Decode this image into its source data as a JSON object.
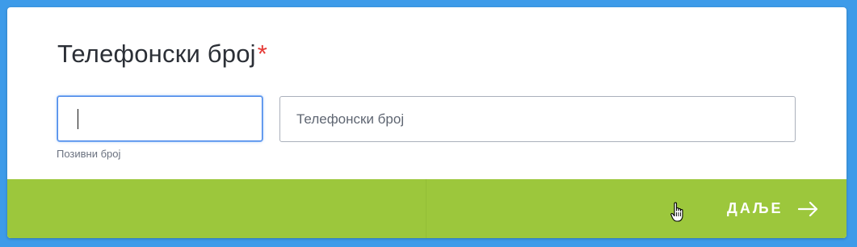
{
  "form": {
    "title": "Телефонски број",
    "required_mark": "*",
    "code_field": {
      "value": "",
      "hint": "Позивни број"
    },
    "phone_field": {
      "placeholder": "Телефонски број",
      "value": ""
    }
  },
  "footer": {
    "next_label": "ДАЉЕ",
    "next_icon": "arrow-right-icon"
  },
  "colors": {
    "background": "#3d9be9",
    "footer": "#9cc73c",
    "focus": "#4a86e8",
    "required": "#e53935"
  }
}
